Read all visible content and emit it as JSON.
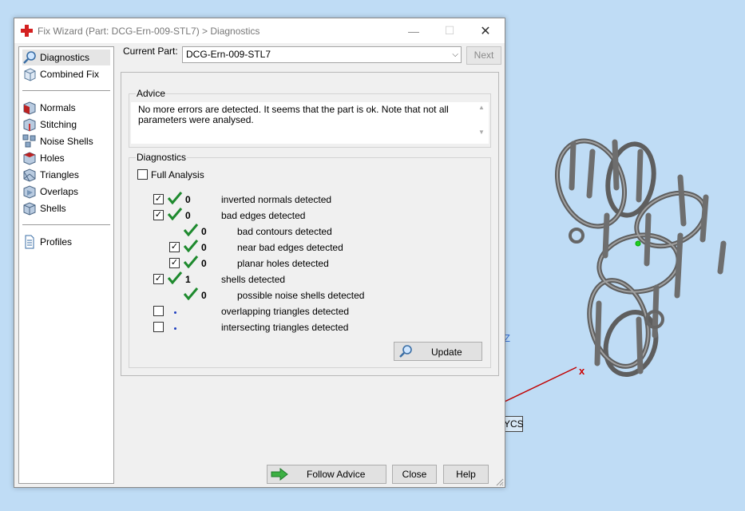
{
  "window": {
    "title": "Fix Wizard (Part: DCG-Ern-009-STL7) > Diagnostics",
    "minimize_glyph": "—",
    "maximize_glyph": "☐",
    "close_glyph": "✕"
  },
  "sidebar": {
    "items": [
      {
        "label": "Diagnostics",
        "icon": "magnifier-icon",
        "selected": true
      },
      {
        "label": "Combined Fix",
        "icon": "cube-icon"
      },
      {
        "label": "Normals",
        "icon": "normals-cube-icon"
      },
      {
        "label": "Stitching",
        "icon": "stitching-cube-icon"
      },
      {
        "label": "Noise Shells",
        "icon": "noise-shells-icon"
      },
      {
        "label": "Holes",
        "icon": "holes-cube-icon"
      },
      {
        "label": "Triangles",
        "icon": "triangles-cube-icon"
      },
      {
        "label": "Overlaps",
        "icon": "overlaps-cube-icon"
      },
      {
        "label": "Shells",
        "icon": "shells-cube-icon"
      },
      {
        "label": "Profiles",
        "icon": "document-icon"
      }
    ]
  },
  "current_part": {
    "label": "Current Part:",
    "value": "DCG-Ern-009-STL7",
    "next_label": "Next"
  },
  "advice": {
    "title": "Advice",
    "text": "No more errors are detected. It seems that the part is ok. Note that not all parameters were analysed."
  },
  "diagnostics": {
    "title": "Diagnostics",
    "full_analysis_label": "Full Analysis",
    "rows": [
      {
        "checked": true,
        "status": "ok",
        "count": "0",
        "label": "inverted normals detected"
      },
      {
        "checked": true,
        "status": "ok",
        "count": "0",
        "label": "bad edges detected"
      },
      {
        "checked": null,
        "status": "ok",
        "count": "0",
        "label": "bad contours detected"
      },
      {
        "checked": true,
        "status": "ok",
        "count": "0",
        "label": "near bad edges detected"
      },
      {
        "checked": true,
        "status": "ok",
        "count": "0",
        "label": "planar holes detected"
      },
      {
        "checked": true,
        "status": "ok",
        "count": "1",
        "label": "shells detected"
      },
      {
        "checked": null,
        "status": "ok",
        "count": "0",
        "label": "possible noise shells detected"
      },
      {
        "checked": false,
        "status": "pending",
        "count": "",
        "label": "overlapping triangles detected"
      },
      {
        "checked": false,
        "status": "pending",
        "count": "",
        "label": "intersecting triangles detected"
      }
    ],
    "update_label": "Update"
  },
  "buttons": {
    "follow_advice": "Follow Advice",
    "close": "Close",
    "help": "Help"
  },
  "viewport": {
    "axis_z": "Z",
    "axis_x": "x",
    "ucs_label": "YCS"
  },
  "colors": {
    "background": "#bfdcf5",
    "check_green": "#1e8a2e",
    "model_gray": "#7a7a7a",
    "x_axis": "#c00000"
  }
}
